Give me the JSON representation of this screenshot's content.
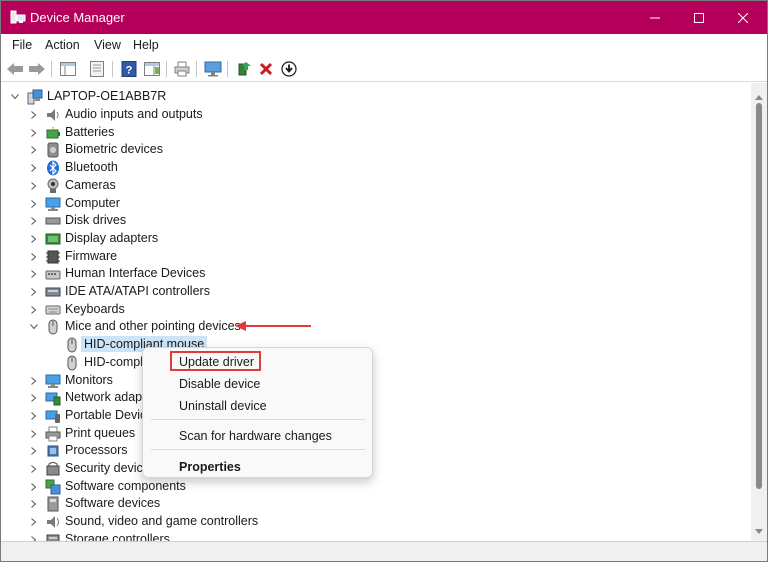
{
  "window": {
    "title": "Device Manager"
  },
  "menubar": {
    "items": [
      "File",
      "Action",
      "View",
      "Help"
    ]
  },
  "tree": {
    "root": "LAPTOP-OE1ABB7R",
    "categories": [
      "Audio inputs and outputs",
      "Batteries",
      "Biometric devices",
      "Bluetooth",
      "Cameras",
      "Computer",
      "Disk drives",
      "Display adapters",
      "Firmware",
      "Human Interface Devices",
      "IDE ATA/ATAPI controllers",
      "Keyboards",
      "Mice and other pointing devices"
    ],
    "mice_children": [
      "HID-compliant mouse",
      "HID-compli"
    ],
    "after_categories": [
      "Monitors",
      "Network adapt",
      "Portable Device",
      "Print queues",
      "Processors",
      "Security device",
      "Software components",
      "Software devices",
      "Sound, video and game controllers",
      "Storage controllers"
    ]
  },
  "context_menu": {
    "update": "Update driver",
    "disable": "Disable device",
    "uninstall": "Uninstall device",
    "scan": "Scan for hardware changes",
    "properties": "Properties"
  },
  "colors": {
    "titlebar": "#b4005a",
    "selection": "#cce4f7",
    "annotation": "#e03a3a",
    "delete_icon": "#d11a1a"
  }
}
